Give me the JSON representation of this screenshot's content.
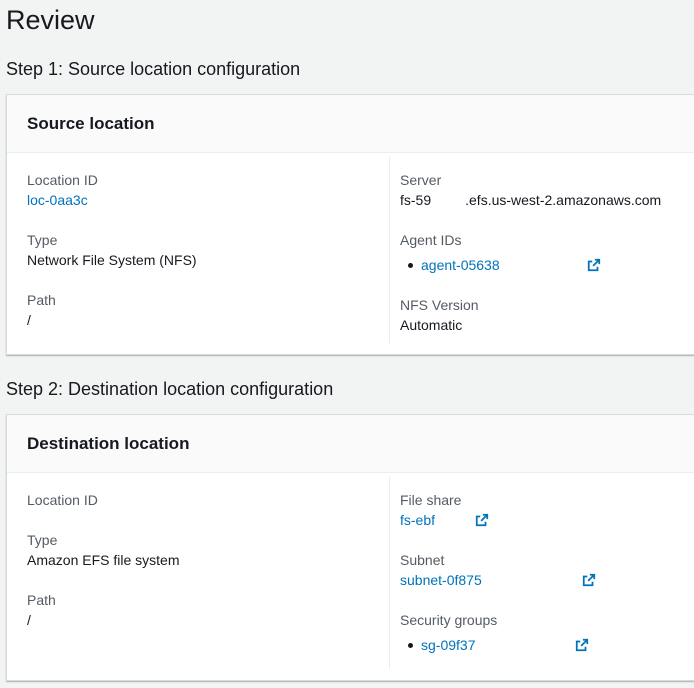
{
  "page": {
    "title": "Review"
  },
  "step1": {
    "heading": "Step 1: Source location configuration",
    "card_title": "Source location",
    "location_id": {
      "label": "Location ID",
      "value": "loc-0aa3c"
    },
    "type": {
      "label": "Type",
      "value": "Network File System (NFS)"
    },
    "path": {
      "label": "Path",
      "value": "/"
    },
    "server": {
      "label": "Server",
      "value_prefix": "fs-59",
      "value_suffix": ".efs.us-west-2.amazonaws.com"
    },
    "agent_ids": {
      "label": "Agent IDs",
      "items": [
        "agent-05638"
      ]
    },
    "nfs_version": {
      "label": "NFS Version",
      "value": "Automatic"
    }
  },
  "step2": {
    "heading": "Step 2: Destination location configuration",
    "card_title": "Destination location",
    "location_id": {
      "label": "Location ID",
      "value": ""
    },
    "type": {
      "label": "Type",
      "value": "Amazon EFS file system"
    },
    "path": {
      "label": "Path",
      "value": "/"
    },
    "file_share": {
      "label": "File share",
      "value": "fs-ebf"
    },
    "subnet": {
      "label": "Subnet",
      "value": "subnet-0f875"
    },
    "security_groups": {
      "label": "Security groups",
      "items": [
        "sg-09f37"
      ]
    }
  },
  "icons": {
    "external_link": "external-link-icon"
  },
  "colors": {
    "link": "#0073bb",
    "background": "#f2f3f3",
    "card": "#ffffff",
    "label": "#545b64"
  }
}
